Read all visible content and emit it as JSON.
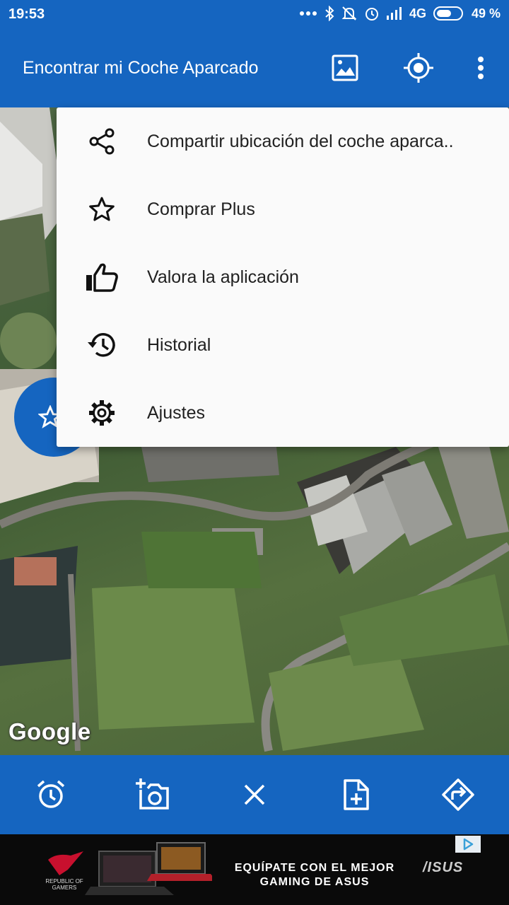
{
  "status_bar": {
    "time": "19:53",
    "network": "4G",
    "battery": "49 %"
  },
  "app_bar": {
    "title": "Encontrar mi Coche Aparcado",
    "actions": [
      "image-icon",
      "my-location-icon",
      "more-vert-icon"
    ]
  },
  "menu": {
    "items": [
      {
        "label": "Compartir ubicación del coche aparca..",
        "icon": "share-icon"
      },
      {
        "label": "Comprar Plus",
        "icon": "star-outline-icon"
      },
      {
        "label": "Valora la aplicación",
        "icon": "thumb-up-icon"
      },
      {
        "label": "Historial",
        "icon": "history-icon"
      },
      {
        "label": "Ajustes",
        "icon": "settings-icon"
      }
    ]
  },
  "map": {
    "attribution": "Google"
  },
  "bottom_bar": {
    "buttons": [
      "alarm-icon",
      "add-photo-icon",
      "close-icon",
      "note-add-icon",
      "directions-icon"
    ]
  },
  "ad": {
    "headline_line1": "EQUÍPATE CON EL MEJOR",
    "headline_line2": "GAMING DE ASUS",
    "brand": "/ISUS",
    "rog_text": "REPUBLIC OF GAMERS"
  },
  "colors": {
    "primary": "#1565c0",
    "menu_background": "#fafafa",
    "menu_text": "#212121"
  }
}
